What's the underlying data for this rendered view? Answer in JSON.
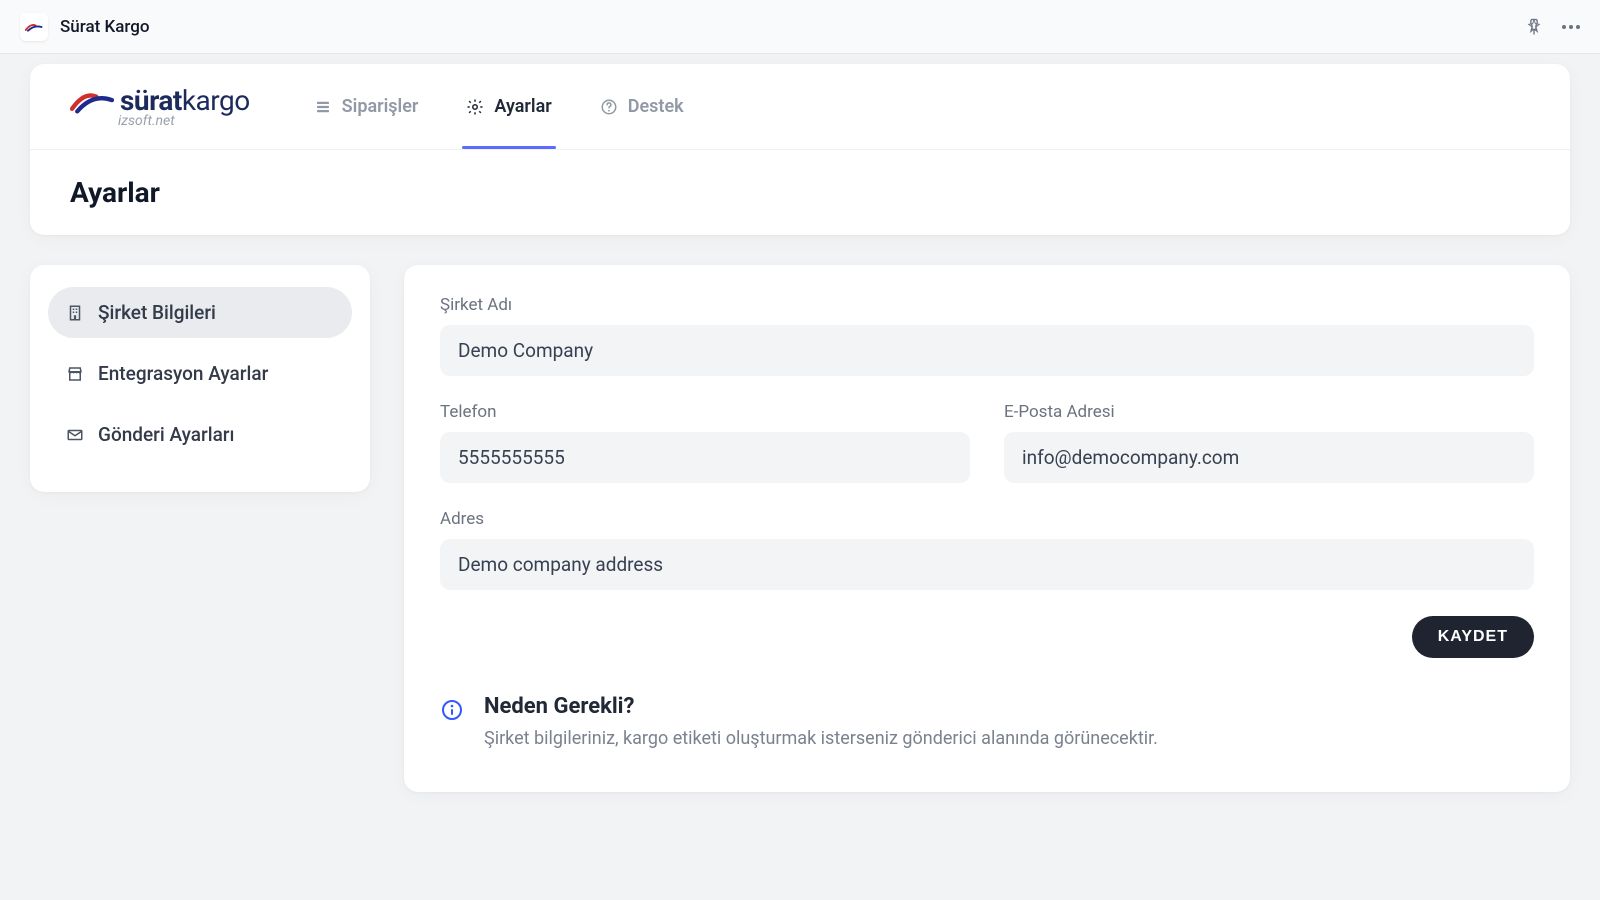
{
  "topbar": {
    "app_title": "Sürat Kargo"
  },
  "logo": {
    "brand_a": "sürat",
    "brand_b": "kargo",
    "subtitle": "izsoft.net"
  },
  "nav": {
    "items": [
      {
        "label": "Siparişler",
        "active": false
      },
      {
        "label": "Ayarlar",
        "active": true
      },
      {
        "label": "Destek",
        "active": false
      }
    ]
  },
  "page": {
    "title": "Ayarlar"
  },
  "sidebar": {
    "items": [
      {
        "label": "Şirket Bilgileri",
        "active": true
      },
      {
        "label": "Entegrasyon Ayarlar",
        "active": false
      },
      {
        "label": "Gönderi Ayarları",
        "active": false
      }
    ]
  },
  "form": {
    "company_label": "Şirket Adı",
    "company_value": "Demo Company",
    "phone_label": "Telefon",
    "phone_value": "5555555555",
    "email_label": "E-Posta Adresi",
    "email_value": "info@democompany.com",
    "address_label": "Adres",
    "address_value": "Demo company address",
    "save_label": "KAYDET"
  },
  "info": {
    "title": "Neden Gerekli?",
    "text": "Şirket bilgileriniz, kargo etiketi oluşturmak isterseniz gönderici alanında görünecektir."
  }
}
